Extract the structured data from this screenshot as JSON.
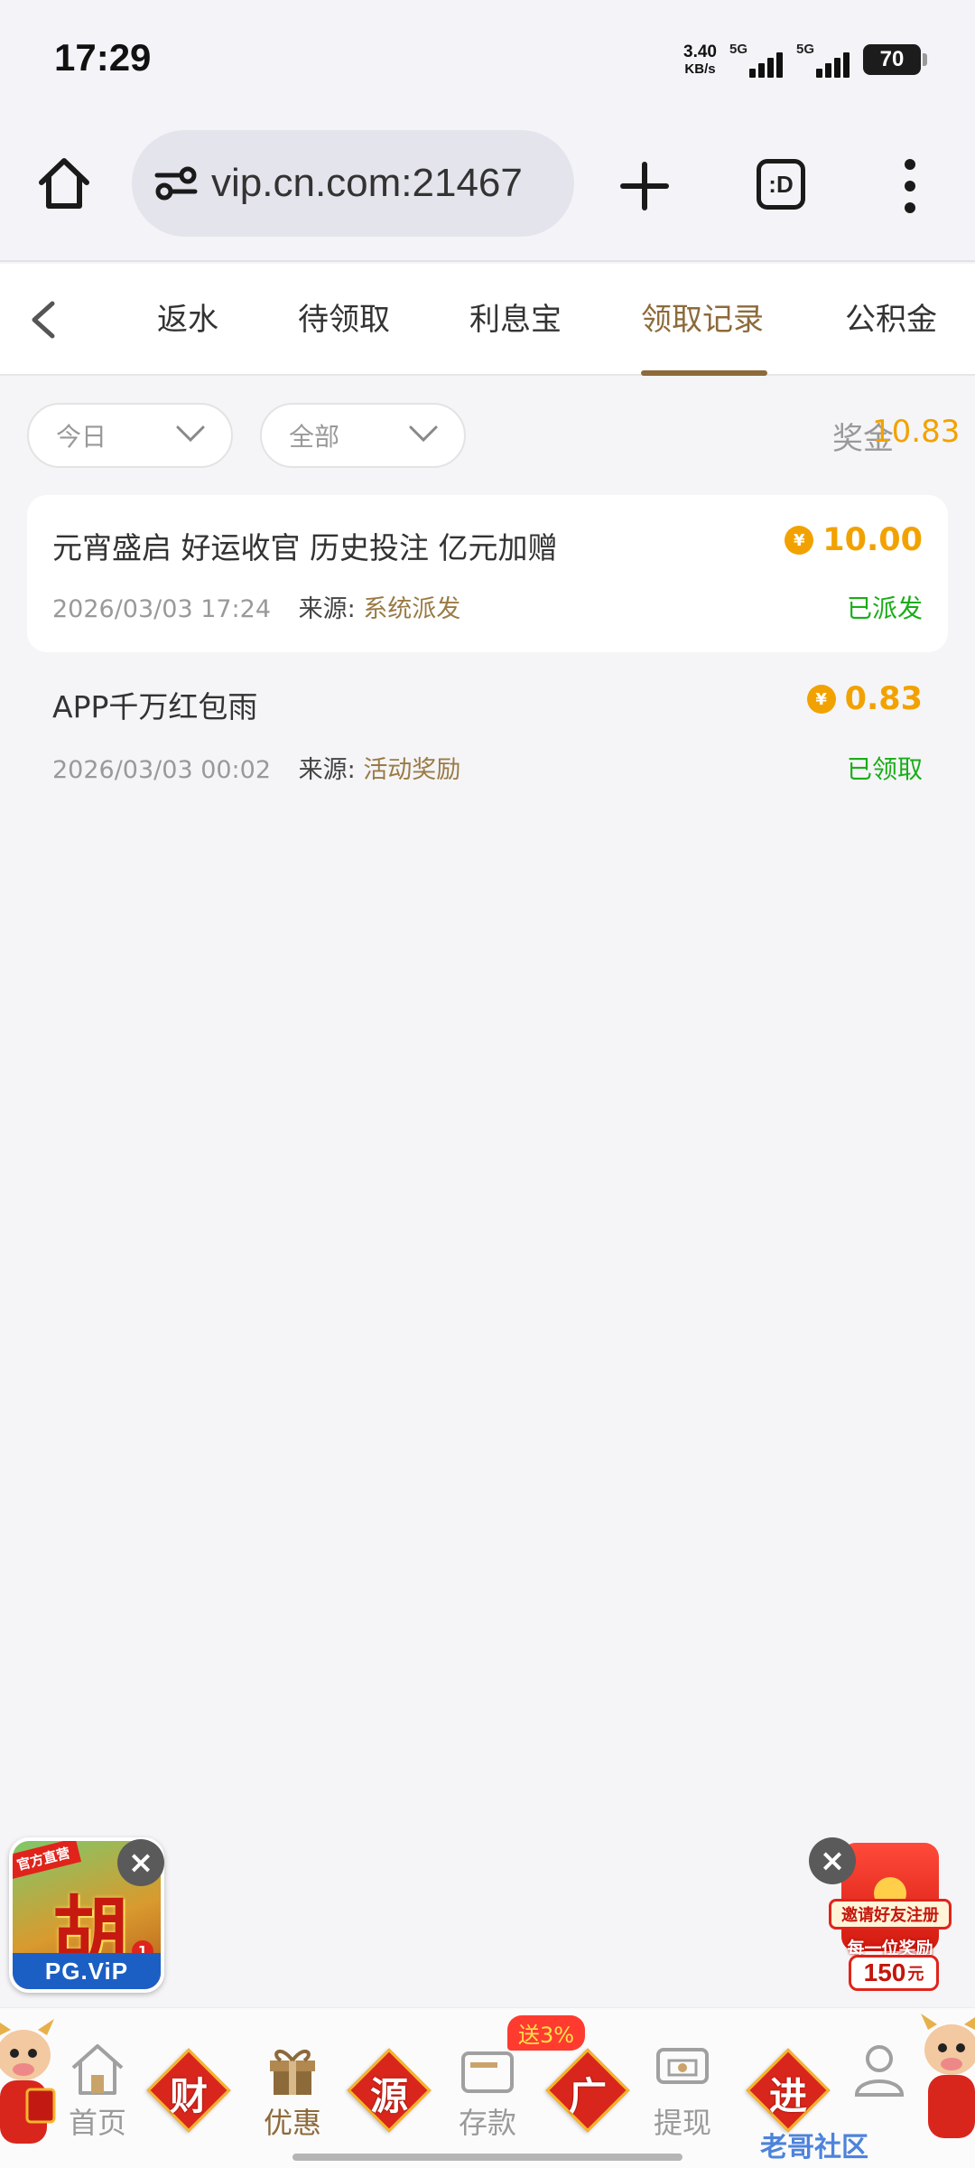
{
  "status_bar": {
    "time": "17:29",
    "net_speed_value": "3.40",
    "net_speed_unit": "KB/s",
    "sim1": "5G",
    "sim2": "5G",
    "battery": "70"
  },
  "browser": {
    "url": "vip.cn.com:21467",
    "tabs_label": ":D"
  },
  "tabs": [
    {
      "label": "返水"
    },
    {
      "label": "待领取"
    },
    {
      "label": "利息宝"
    },
    {
      "label": "领取记录",
      "active": true
    },
    {
      "label": "公积金"
    }
  ],
  "filters": {
    "date": "今日",
    "type": "全部"
  },
  "bonus": {
    "label": "奖金",
    "value": "10.83"
  },
  "records": [
    {
      "title": "元宵盛启 好运收官 历史投注 亿元加赠",
      "amount": "10.00",
      "time": "2026/03/03 17:24",
      "source_label": "来源:",
      "source": "系统派发",
      "status": "已派发"
    },
    {
      "title": "APP千万红包雨",
      "amount": "0.83",
      "time": "2026/03/03 00:02",
      "source_label": "来源:",
      "source": "活动奖励",
      "status": "已领取"
    }
  ],
  "float_left": {
    "tag": "官方直营",
    "glyph": "胡",
    "brand": "PG.ViP",
    "badge": "1"
  },
  "float_right": {
    "banner": "邀请好友注册",
    "sub": "每一位奖励",
    "amount": "150",
    "unit": "元"
  },
  "bottom_nav": {
    "home": "首页",
    "promo": "优惠",
    "deposit": "存款",
    "withdraw": "提现",
    "diamond_1": "财",
    "diamond_2": "源",
    "diamond_3": "广",
    "diamond_4": "进",
    "deposit_badge": "送3%"
  },
  "watermark": "老哥社区",
  "colors": {
    "accent_gold": "#8d6a3a",
    "amount_orange": "#f2a200",
    "status_green": "#1aad19",
    "page_bg": "#f5f5f7"
  }
}
